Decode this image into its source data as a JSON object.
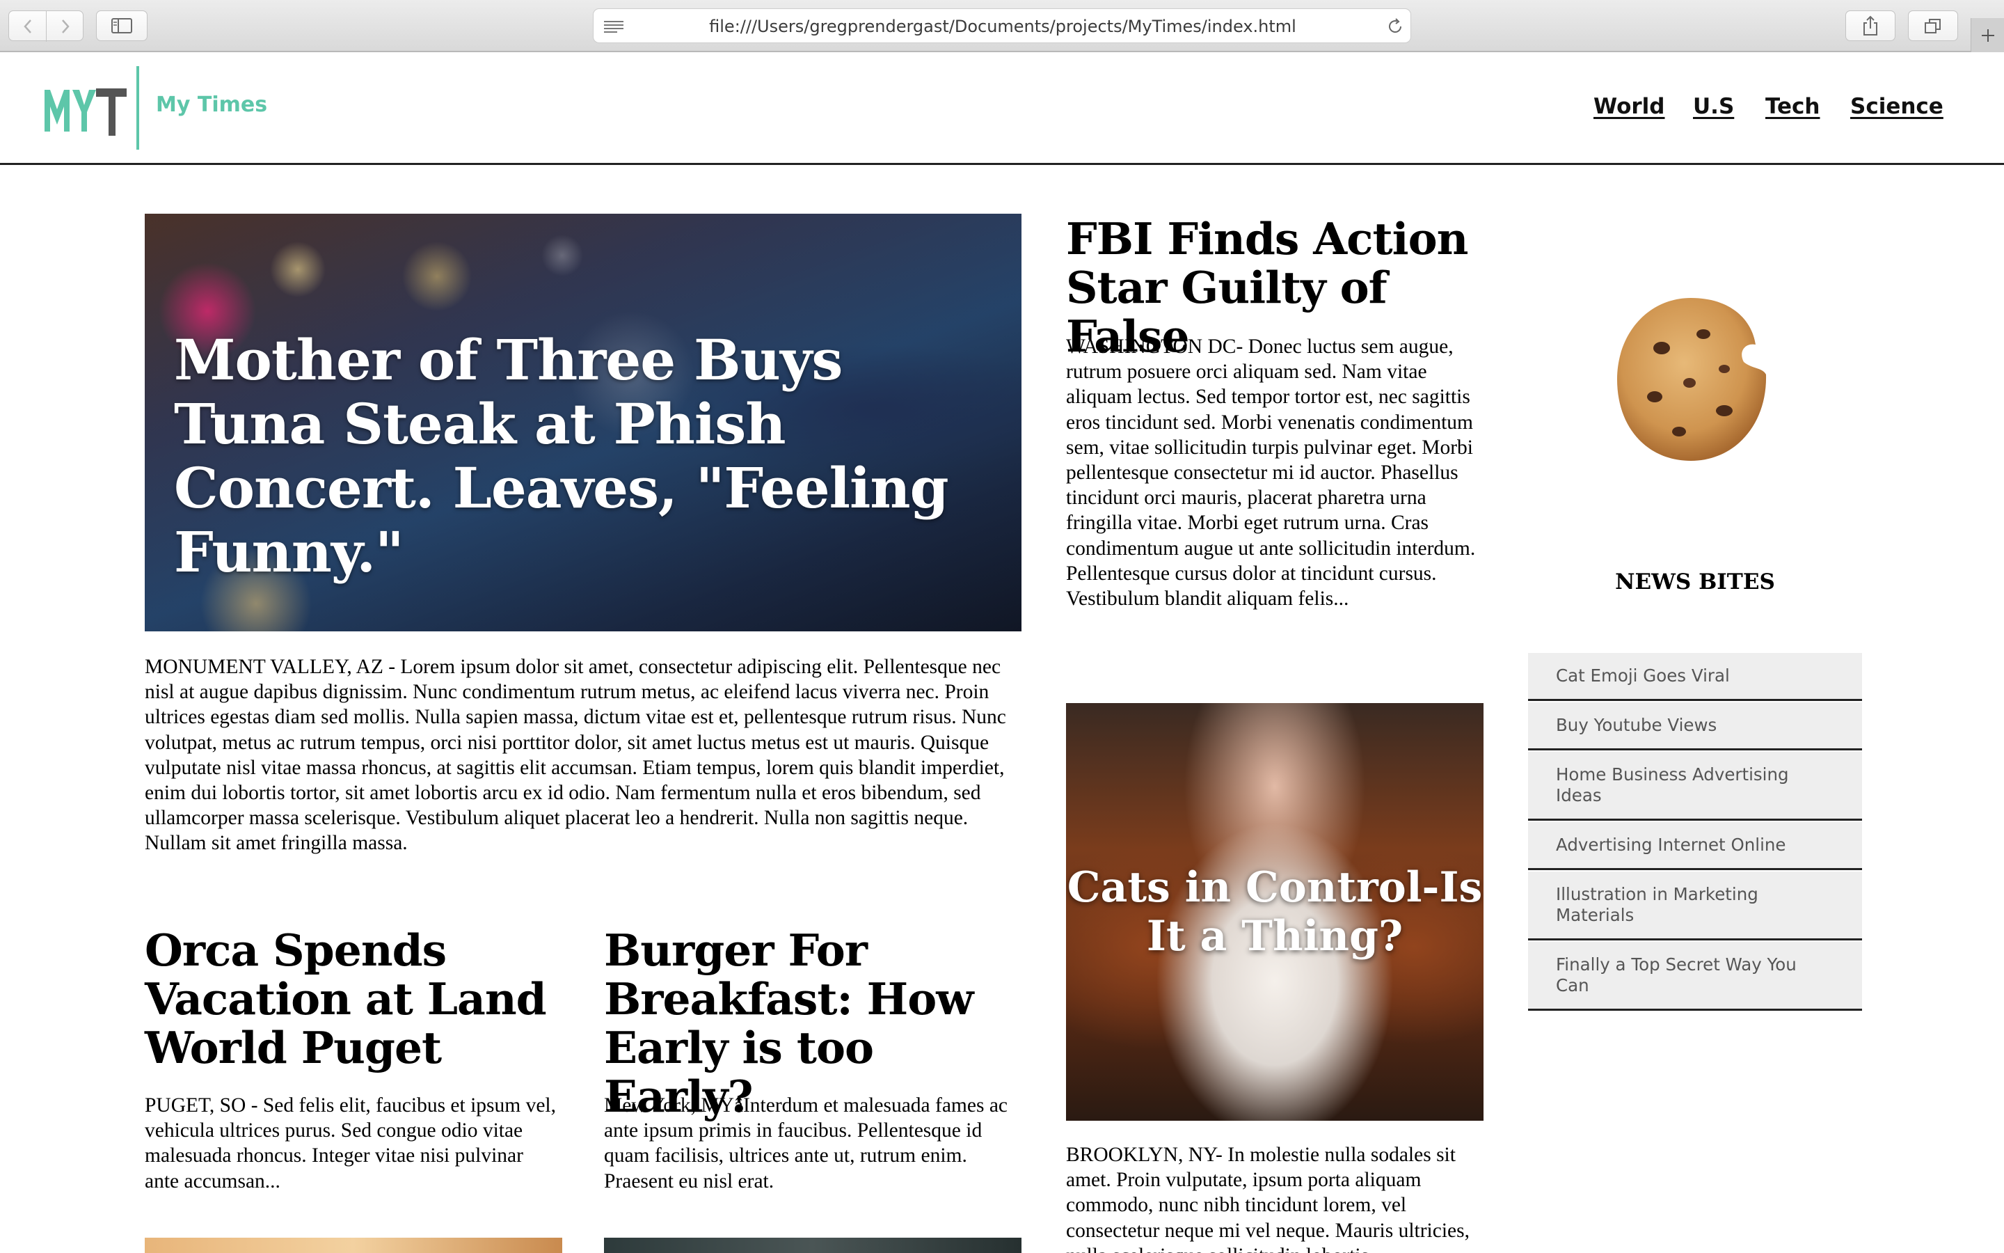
{
  "browser": {
    "url": "file:///Users/gregprendergast/Documents/projects/MyTimes/index.html"
  },
  "header": {
    "logo_text": "MYT",
    "brand": "My Times",
    "nav": [
      "World",
      "U.S",
      "Tech",
      "Science"
    ]
  },
  "hero": {
    "title": "Mother of Three Buys Tuna Steak at Phish Concert. Leaves, \"Feeling Funny.\"",
    "body": "MONUMENT VALLEY, AZ - Lorem ipsum dolor sit amet, consectetur adipiscing elit. Pellentesque nec nisl at augue dapibus dignissim. Nunc condimentum rutrum metus, ac eleifend lacus viverra nec. Proin ultrices egestas diam sed mollis. Nulla sapien massa, dictum vitae est et, pellentesque rutrum risus. Nunc volutpat, metus ac rutrum tempus, orci nisi porttitor dolor, sit amet luctus metus est ut mauris. Quisque vulputate nisl vitae massa rhoncus, at sagittis elit accumsan. Etiam tempus, lorem quis blandit imperdiet, enim dui lobortis tortor, sit amet lobortis arcu ex id odio. Nam fermentum nulla et eros bibendum, sed ullamcorper massa scelerisque. Vestibulum aliquet placerat leo a hendrerit. Nulla non sagittis neque. Nullam sit amet fringilla massa."
  },
  "articles": {
    "orca": {
      "title": "Orca Spends Vacation at Land World Puget",
      "body": "PUGET, SO - Sed felis elit, faucibus et ipsum vel, vehicula ultrices purus. Sed congue odio vitae malesuada rhoncus. Integer vitae nisi pulvinar ante accumsan..."
    },
    "burger": {
      "title": "Burger For Breakfast: How Early is too Early?",
      "body": "Mew York, MYâInterdum et malesuada fames ac ante ipsum primis in faucibus. Pellentesque id quam facilisis, ultrices ante ut, rutrum enim. Praesent eu nisl erat."
    },
    "fbi": {
      "title": "FBI Finds Action Star Guilty of False",
      "body": "WASHINGTON DC- Donec luctus sem augue, rutrum posuere orci aliquam sed. Nam vitae aliquam lectus. Sed tempor tortor est, nec sagittis eros tincidunt sed. Morbi venenatis condimentum sem, vitae sollicitudin turpis pulvinar eget. Morbi pellentesque consectetur mi id auctor. Phasellus tincidunt orci mauris, placerat pharetra urna fringilla vitae. Morbi eget rutrum urna. Cras condimentum augue ut ante sollicitudin interdum. Pellentesque cursus dolor at tincidunt cursus. Vestibulum blandit aliquam felis..."
    },
    "cats": {
      "title": "Cats in Control-Is It a Thing?",
      "body": "BROOKLYN, NY- In molestie nulla sodales sit amet. Proin vulputate, ipsum porta aliquam commodo, nunc nibh tincidunt lorem, vel consectetur neque mi vel neque. Mauris ultricies, nulla scelerisque sollicitudin lobortis"
    }
  },
  "news_bites": {
    "title": "NEWS BITES",
    "items": [
      "Cat Emoji Goes Viral",
      "Buy Youtube Views",
      "Home Business Advertising Ideas",
      "Advertising Internet Online",
      "Illustration in Marketing Materials",
      "Finally a Top Secret Way You Can"
    ]
  },
  "colors": {
    "brand": "#5dc6a9",
    "chrome": "#dcdcdc",
    "nav_text": "#111111",
    "list_bg": "#eeeeee"
  },
  "icons": [
    "back-icon",
    "forward-icon",
    "sidebar-icon",
    "reader-icon",
    "reload-icon",
    "share-icon",
    "tabs-icon",
    "new-tab-icon"
  ]
}
